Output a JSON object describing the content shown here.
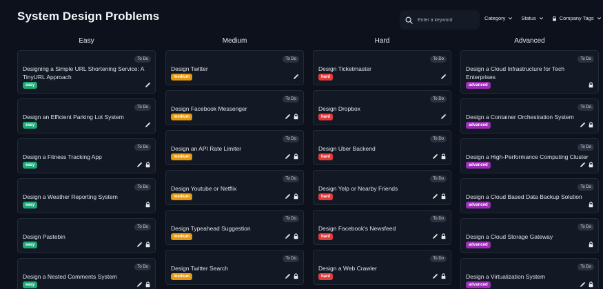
{
  "page": {
    "title": "System Design Problems"
  },
  "search": {
    "placeholder": "Enter a keyword"
  },
  "filters": {
    "category": "Category",
    "status": "Status",
    "company_tags": "Company Tags"
  },
  "colors": {
    "easy": "#1ea876",
    "medium": "#e8980e",
    "hard": "#e23b3b",
    "advanced": "#9b2db5"
  },
  "columns": [
    {
      "title": "Easy",
      "key": "easy",
      "cards": [
        {
          "title": "Designing a Simple URL Shortening Service: A TinyURL Approach",
          "status": "To Do",
          "level": "easy",
          "edit": true,
          "lock": false
        },
        {
          "title": "Design an Efficient Parking Lot System",
          "status": "To Do",
          "level": "easy",
          "edit": true,
          "lock": false
        },
        {
          "title": "Design a Fitness Tracking App",
          "status": "To Do",
          "level": "easy",
          "edit": true,
          "lock": true
        },
        {
          "title": "Design a Weather Reporting System",
          "status": "To Do",
          "level": "easy",
          "edit": false,
          "lock": true
        },
        {
          "title": "Design Pastebin",
          "status": "To Do",
          "level": "easy",
          "edit": true,
          "lock": true
        },
        {
          "title": "Design a Nested Comments System",
          "status": "To Do",
          "level": "easy",
          "edit": true,
          "lock": true
        }
      ]
    },
    {
      "title": "Medium",
      "key": "medium",
      "cards": [
        {
          "title": "Design Twitter",
          "status": "To Do",
          "level": "medium",
          "edit": true,
          "lock": false
        },
        {
          "title": "Design Facebook Messenger",
          "status": "To Do",
          "level": "medium",
          "edit": true,
          "lock": true
        },
        {
          "title": "Design an API Rate Limiter",
          "status": "To Do",
          "level": "medium",
          "edit": true,
          "lock": true
        },
        {
          "title": "Design Youtube or Netflix",
          "status": "To Do",
          "level": "medium",
          "edit": true,
          "lock": true
        },
        {
          "title": "Design Typeahead Suggestion",
          "status": "To Do",
          "level": "medium",
          "edit": true,
          "lock": true
        },
        {
          "title": "Design Twitter Search",
          "status": "To Do",
          "level": "medium",
          "edit": true,
          "lock": true
        }
      ]
    },
    {
      "title": "Hard",
      "key": "hard",
      "cards": [
        {
          "title": "Design Ticketmaster",
          "status": "To Do",
          "level": "hard",
          "edit": true,
          "lock": false
        },
        {
          "title": "Design Dropbox",
          "status": "To Do",
          "level": "hard",
          "edit": true,
          "lock": false
        },
        {
          "title": "Design Uber Backend",
          "status": "To Do",
          "level": "hard",
          "edit": true,
          "lock": true
        },
        {
          "title": "Design Yelp or Nearby Friends",
          "status": "To Do",
          "level": "hard",
          "edit": true,
          "lock": true
        },
        {
          "title": "Design Facebook's Newsfeed",
          "status": "To Do",
          "level": "hard",
          "edit": true,
          "lock": true
        },
        {
          "title": "Design a Web Crawler",
          "status": "To Do",
          "level": "hard",
          "edit": true,
          "lock": true
        }
      ]
    },
    {
      "title": "Advanced",
      "key": "advanced",
      "cards": [
        {
          "title": "Design a Cloud Infrastructure for Tech Enterprises",
          "status": "To Do",
          "level": "advanced",
          "edit": false,
          "lock": true
        },
        {
          "title": "Design a Container Orchestration System",
          "status": "To Do",
          "level": "advanced",
          "edit": true,
          "lock": true
        },
        {
          "title": "Design a High-Performance Computing Cluster",
          "status": "To Do",
          "level": "advanced",
          "edit": true,
          "lock": true
        },
        {
          "title": "Design a Cloud Based Data Backup Solution",
          "status": "To Do",
          "level": "advanced",
          "edit": false,
          "lock": true
        },
        {
          "title": "Design a Cloud Storage Gateway",
          "status": "To Do",
          "level": "advanced",
          "edit": false,
          "lock": true
        },
        {
          "title": "Design a Virtualization System",
          "status": "To Do",
          "level": "advanced",
          "edit": true,
          "lock": true
        }
      ]
    }
  ]
}
